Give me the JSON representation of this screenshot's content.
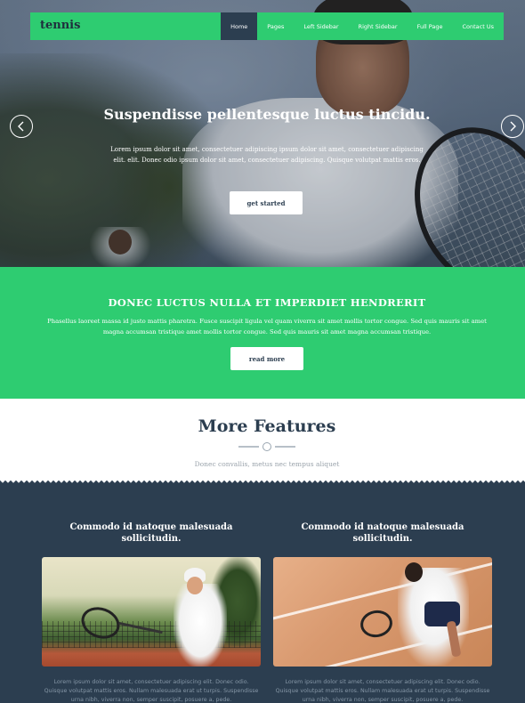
{
  "nav": {
    "brand": "tennis",
    "items": [
      {
        "label": "Home",
        "active": true
      },
      {
        "label": "Pages"
      },
      {
        "label": "Left Sidebar"
      },
      {
        "label": "Right Sidebar"
      },
      {
        "label": "Full Page"
      },
      {
        "label": "Contact Us"
      }
    ]
  },
  "hero": {
    "title": "Suspendisse pellentesque luctus tincidu.",
    "text": "Lorem ipsum dolor sit amet, consectetuer adipiscing ipsum dolor sit amet, consectetuer adipiscing elit. elit. Donec odio ipsum dolor sit amet, consectetuer adipiscing. Quisque volutpat mattis eros.",
    "button": "get started",
    "prev_icon": "chevron-left-icon",
    "next_icon": "chevron-right-icon"
  },
  "green": {
    "heading": "DONEC LUCTUS NULLA ET IMPERDIET HENDRERIT",
    "text": "Phasellus laoreet massa id justo mattis pharetra. Fusce suscipit ligula vel quam viverra sit amet mollis tortor congue. Sed quis mauris sit amet magna accumsan tristique amet mollis tortor congue. Sed quis mauris sit amet magna accumsan tristique.",
    "button": "read more"
  },
  "features": {
    "heading": "More Features",
    "subtitle": "Donec convallis, metus nec tempus aliquet"
  },
  "columns": [
    {
      "heading": "Commodo id natoque malesuada sollicitudin.",
      "text": "Lorem ipsum dolor sit amet, consectetuer adipiscing elit. Donec odio. Quisque volutpat mattis eros. Nullam malesuada erat ut turpis. Suspendisse urna nibh, viverra non, semper suscipit, posuere a, pede."
    },
    {
      "heading": "Commodo id natoque malesuada sollicitudin.",
      "text": "Lorem ipsum dolor sit amet, consectetuer adipiscing elit. Donec odio. Quisque volutpat mattis eros. Nullam malesuada erat ut turpis. Suspendisse urna nibh, viverra non, semper suscipit, posuere a, pede."
    }
  ],
  "colors": {
    "accent": "#2ecc71",
    "dark": "#2c3e50"
  }
}
